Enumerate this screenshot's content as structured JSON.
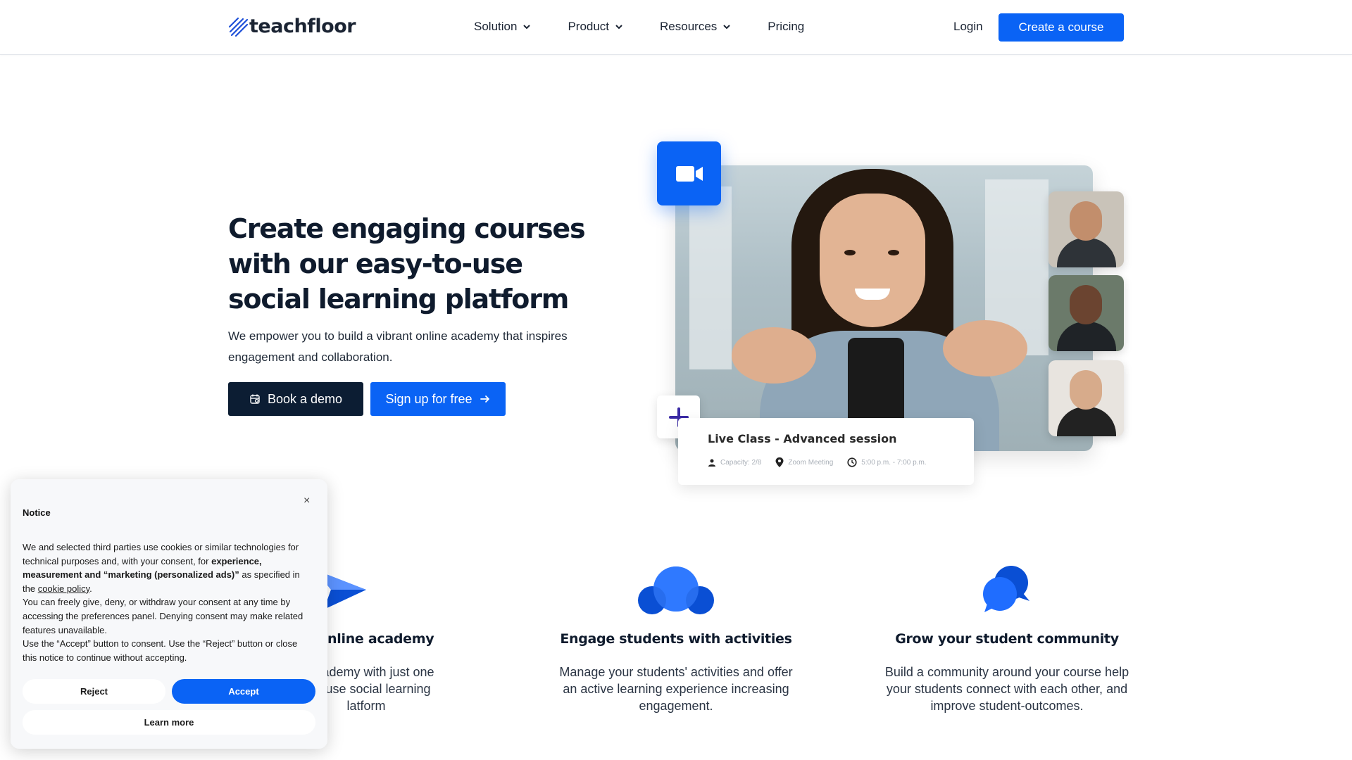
{
  "brand": {
    "name": "teachfloor",
    "accent": "#0a63f5",
    "dark": "#0c1d33"
  },
  "nav": {
    "items": [
      {
        "label": "Solution",
        "has_dropdown": true
      },
      {
        "label": "Product",
        "has_dropdown": true
      },
      {
        "label": "Resources",
        "has_dropdown": true
      },
      {
        "label": "Pricing",
        "has_dropdown": false
      }
    ],
    "login": "Login",
    "cta": "Create a course"
  },
  "hero": {
    "title_lines": [
      "Create engaging courses",
      "with our easy-to-use",
      "social learning platform"
    ],
    "subtitle_lines": [
      "We empower you to build a vibrant online academy that inspires",
      "engagement and collaboration."
    ],
    "btn_demo": "Book a demo",
    "btn_signup": "Sign up for free"
  },
  "live_card": {
    "title": "Live Class - Advanced session",
    "capacity": "Capacity: 2/8",
    "location": "Zoom Meeting",
    "time": "5:00 p.m. - 7:00 p.m."
  },
  "features": [
    {
      "title": "ur online academy",
      "desc_lines": [
        "e academy with just one",
        "y to use social learning",
        "latform"
      ],
      "icon": "paper-plane-icon"
    },
    {
      "title": "Engage students with activities",
      "desc_lines": [
        "Manage your students' activities and offer",
        "an active learning experience increasing",
        "engagement."
      ],
      "icon": "group-bubbles-icon"
    },
    {
      "title": "Grow your student community",
      "desc_lines": [
        "Build a community around your course help",
        "your students connect with each other, and",
        "improve student-outcomes."
      ],
      "icon": "chat-bubbles-icon"
    }
  ],
  "cookie_notice": {
    "close": "×",
    "title": "Notice",
    "p1": "We and selected third parties use cookies or similar technologies for technical purposes and, with your consent, for ",
    "p1_bold": "experience, measurement and “marketing (personalized ads)”",
    "p1_after": " as specified in the ",
    "p1_link": "cookie policy",
    "p1_end": ".",
    "p2": "You can freely give, deny, or withdraw your consent at any time by accessing the preferences panel. Denying consent may make related features unavailable.",
    "p3": "Use the “Accept” button to consent. Use the “Reject” button or close this notice to continue without accepting.",
    "reject": "Reject",
    "accept": "Accept",
    "learn_more": "Learn more"
  }
}
